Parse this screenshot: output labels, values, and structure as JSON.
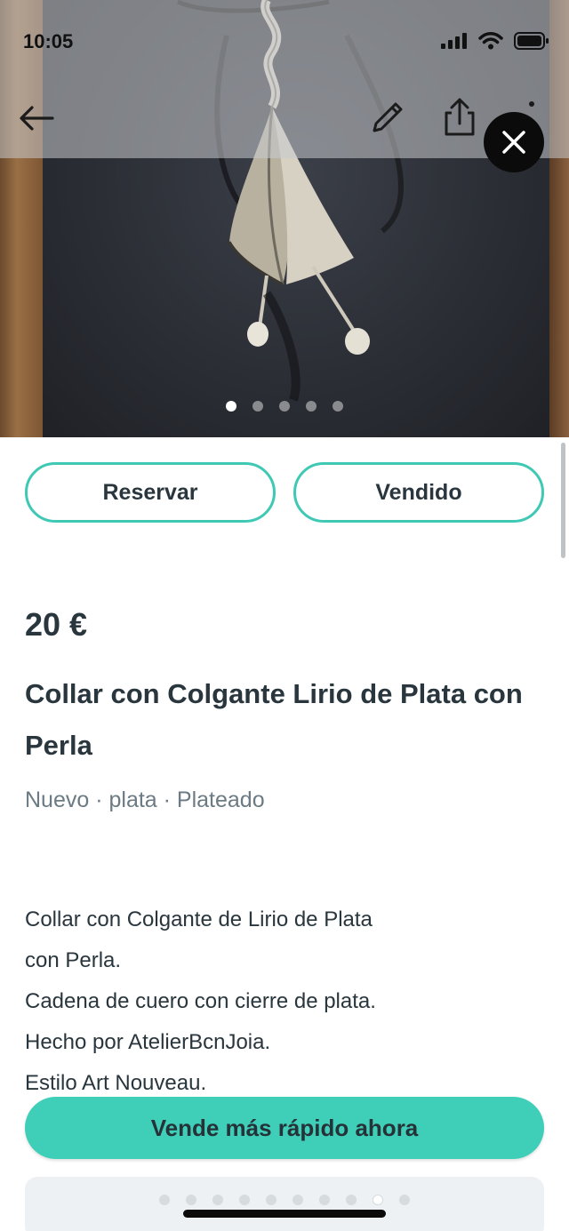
{
  "status_bar": {
    "time": "10:05",
    "icons": [
      "signal-icon",
      "wifi-icon",
      "battery-icon"
    ]
  },
  "nav": {
    "back_icon": "arrow-left-icon",
    "edit_icon": "pencil-icon",
    "share_icon": "share-icon",
    "more_icon": "more-vertical-icon",
    "close_icon": "close-icon"
  },
  "gallery": {
    "image_count": 5,
    "active_index": 0
  },
  "actions": {
    "reserve_label": "Reservar",
    "sold_label": "Vendido"
  },
  "listing": {
    "price": "20 €",
    "title": "Collar con Colgante Lirio de Plata con Perla",
    "meta": "Nuevo · plata · Plateado",
    "description_lines": [
      "Collar con Colgante de Lirio de Plata",
      "con Perla.",
      "Cadena de cuero con cierre de plata.",
      "Hecho por AtelierBcnJoia.",
      "Estilo Art Nouveau."
    ]
  },
  "cta": {
    "label": "Vende más rápido ahora"
  },
  "promo_carousel": {
    "count": 10,
    "active_index": 8
  },
  "colors": {
    "accent": "#3fc9b5",
    "cta": "#3fcfb9",
    "text": "#29363d",
    "muted": "#6b7a83"
  }
}
